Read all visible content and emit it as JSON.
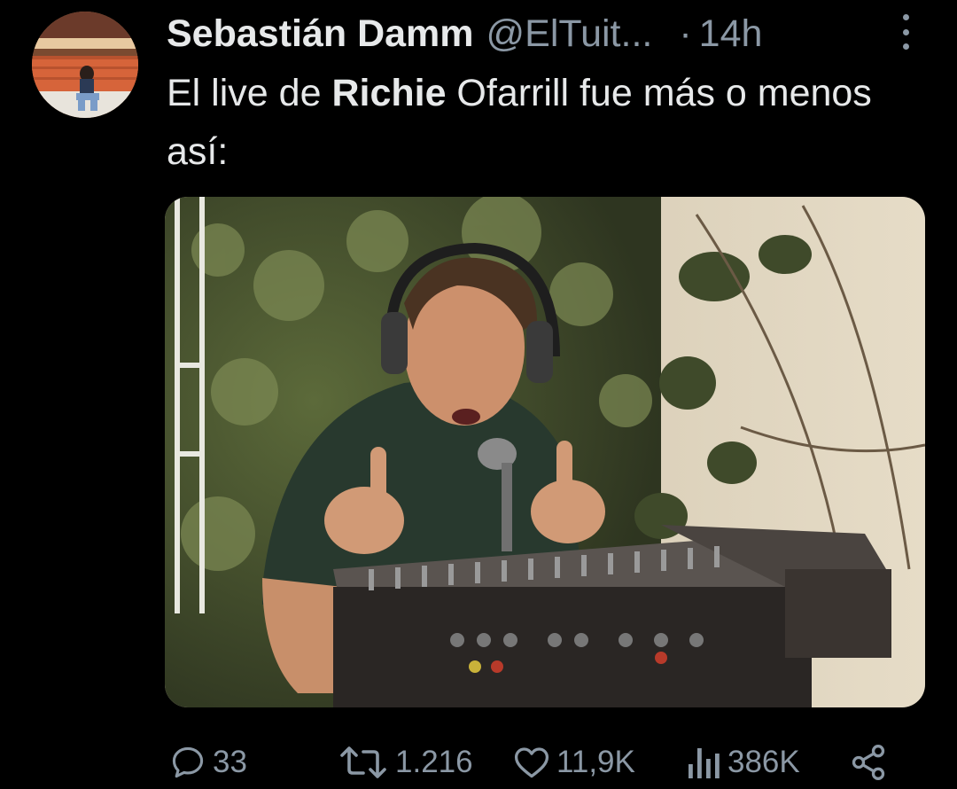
{
  "tweet": {
    "author_name": "Sebastián Damm",
    "handle": "@ElTuit...",
    "separator": "·",
    "time": "14h",
    "text_before": "El live de ",
    "text_bold": "Richie",
    "text_after": " Ofarrill fue más o menos así:"
  },
  "media": {
    "description_icon": "image"
  },
  "actions": {
    "replies": "33",
    "retweets": "1.216",
    "likes": "11,9K",
    "views": "386K"
  },
  "icons": {
    "reply": "reply-icon",
    "retweet": "retweet-icon",
    "like": "heart-icon",
    "views": "views-icon",
    "share": "share-icon",
    "more": "more-icon"
  },
  "colors": {
    "background": "#000000",
    "primary_text": "#e7e9ea",
    "secondary_text": "#8b98a5"
  }
}
